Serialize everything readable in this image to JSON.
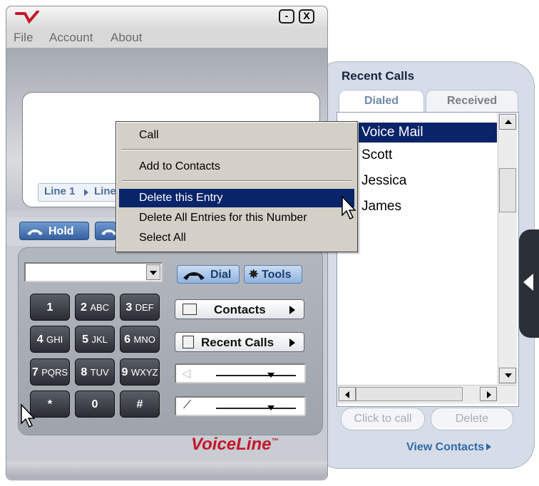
{
  "app": {
    "menu": [
      "File",
      "Account",
      "About"
    ],
    "window_controls": {
      "minimize": "-",
      "close": "X"
    },
    "brand": "VoiceLine",
    "brand_mark": "™"
  },
  "lines": {
    "line1": "Line 1",
    "line2": "Line 2"
  },
  "controls": {
    "hold": "Hold",
    "dial": "Dial",
    "tools": "Tools"
  },
  "keypad": [
    {
      "digit": "1",
      "letters": ""
    },
    {
      "digit": "2",
      "letters": "ABC"
    },
    {
      "digit": "3",
      "letters": "DEF"
    },
    {
      "digit": "4",
      "letters": "GHI"
    },
    {
      "digit": "5",
      "letters": "JKL"
    },
    {
      "digit": "6",
      "letters": "MNO"
    },
    {
      "digit": "7",
      "letters": "PQRS"
    },
    {
      "digit": "8",
      "letters": "TUV"
    },
    {
      "digit": "9",
      "letters": "WXYZ"
    },
    {
      "digit": "*",
      "letters": ""
    },
    {
      "digit": "0",
      "letters": ""
    },
    {
      "digit": "#",
      "letters": ""
    }
  ],
  "side_buttons": {
    "contacts": "Contacts",
    "recent_calls": "Recent Calls"
  },
  "recent_calls": {
    "title": "Recent Calls",
    "tabs": [
      "Dialed",
      "Received"
    ],
    "active_tab": "Dialed",
    "items": [
      "Voice Mail",
      "Scott",
      "Jessica",
      "James"
    ],
    "selected_item": "Voice Mail",
    "click_to_call": "Click to call",
    "delete": "Delete",
    "view_contacts": "View Contacts"
  },
  "context_menu": {
    "items": [
      "Call",
      "Add to Contacts",
      "Delete this Entry",
      "Delete All Entries for this Number",
      "Select All"
    ],
    "highlighted": "Delete this Entry"
  },
  "colors": {
    "selection": "#0a246a",
    "brand_red": "#c4162a",
    "accent_blue": "#2f6aa8"
  },
  "icons": [
    "phone-handset-icon",
    "gear-icon",
    "contacts-card-icon",
    "list-icon",
    "speaker-icon",
    "microphone-icon",
    "dropdown-arrow-icon"
  ]
}
